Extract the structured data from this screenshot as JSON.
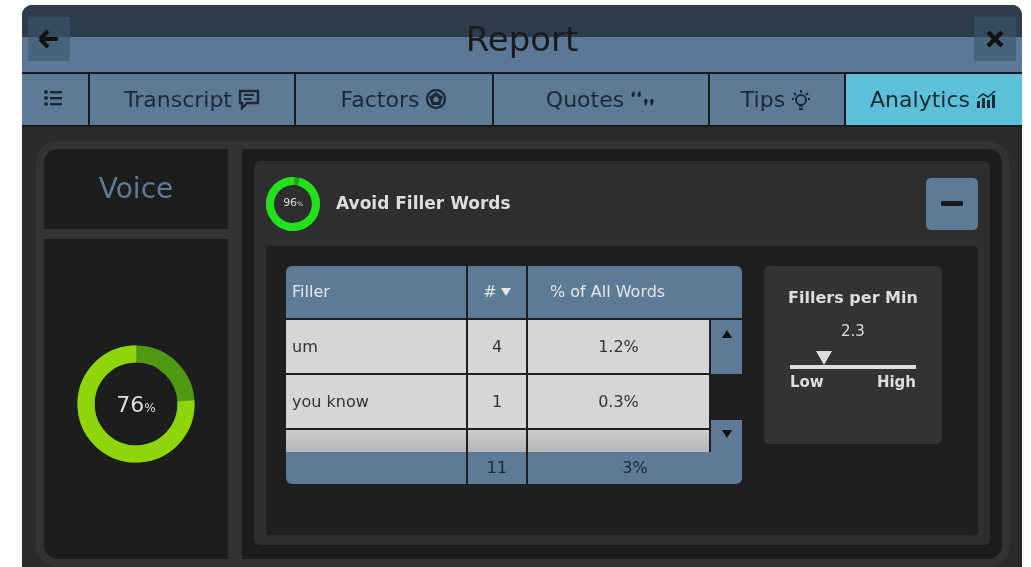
{
  "window": {
    "title": "Report"
  },
  "tabs": [
    {
      "kind": "menu",
      "selected": false
    },
    {
      "label": "Transcript",
      "kind": "chat",
      "selected": false
    },
    {
      "label": "Factors",
      "kind": "pentagon",
      "selected": false
    },
    {
      "label": "Quotes",
      "kind": "quote",
      "selected": false
    },
    {
      "label": "Tips",
      "kind": "bulb",
      "selected": false
    },
    {
      "label": "Analytics",
      "kind": "chart",
      "selected": true
    }
  ],
  "sidebar": {
    "title": "Voice",
    "score": {
      "value": "76",
      "unit": "%"
    }
  },
  "section": {
    "title": "Avoid Filler Words",
    "score": {
      "value": "96",
      "unit": "%"
    },
    "expanded": true,
    "table": {
      "columns": [
        "Filler",
        "#",
        "% of All Words"
      ],
      "rows": [
        {
          "filler": "um",
          "count": "4",
          "percent": "1.2%"
        },
        {
          "filler": "you know",
          "count": "1",
          "percent": "0.3%"
        },
        {
          "partial": true
        }
      ],
      "totals": {
        "count": "11",
        "percent": "3%"
      }
    },
    "rate": {
      "title": "Fillers per Min",
      "value": "2.3",
      "level": 0.27,
      "low": "Low",
      "high": "High"
    }
  }
}
